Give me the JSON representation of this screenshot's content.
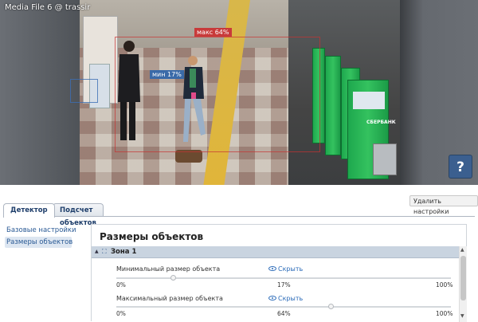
{
  "video": {
    "title": "Media File 6 @ trassir",
    "max_label": "макс 64%",
    "min_label": "мин 17%",
    "atm_brand": "СБЕРБАНК",
    "help_label": "?"
  },
  "toolbar": {
    "delete_label": "Удалить настройки"
  },
  "tabs": [
    {
      "label": "Детектор",
      "active": true
    },
    {
      "label": "Подсчет объектов",
      "active": false
    }
  ],
  "sidebar": {
    "items": [
      {
        "label": "Базовые настройки",
        "active": false
      },
      {
        "label": "Размеры объектов",
        "active": true
      }
    ]
  },
  "panel": {
    "title": "Размеры объектов",
    "zone_label": "Зона 1",
    "rows": [
      {
        "label": "Минимальный размер объекта",
        "hide_label": "Скрыть",
        "min": "0%",
        "value_label": "17%",
        "max": "100%",
        "value": 17
      },
      {
        "label": "Максимальный размер объекта",
        "hide_label": "Скрыть",
        "min": "0%",
        "value_label": "64%",
        "max": "100%",
        "value": 64
      }
    ]
  },
  "colors": {
    "accent": "#2a6ab8",
    "max_frame": "#c83a3a",
    "min_frame": "#3a6aa8",
    "atm_green": "#21a84f"
  }
}
